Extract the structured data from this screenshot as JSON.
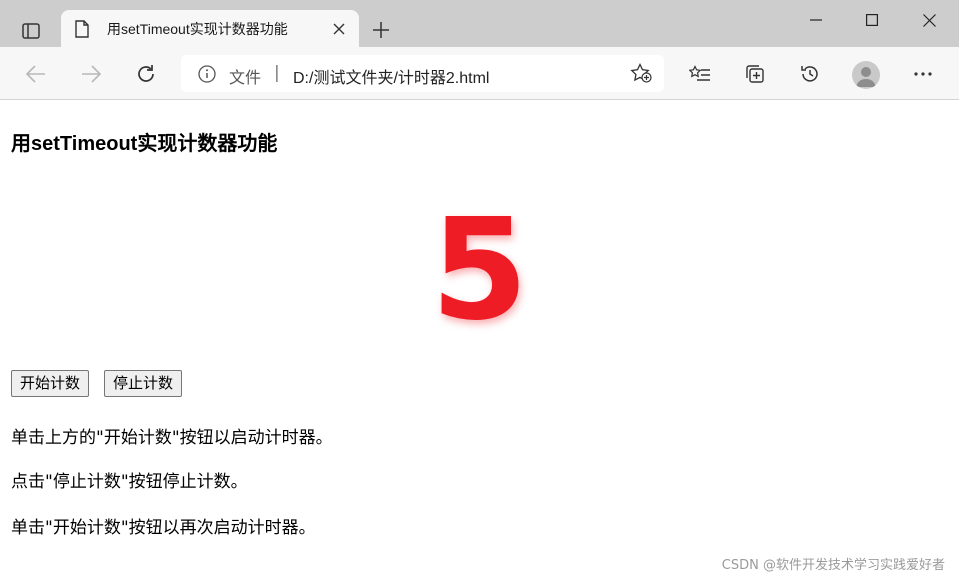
{
  "browser": {
    "tab_title": "用setTimeout实现计数器功能",
    "address": {
      "scheme_label": "文件",
      "separator": "|",
      "url": "D:/测试文件夹/计时器2.html"
    },
    "icons": {
      "tab_actions": "tab-actions-icon",
      "tab_doc": "document-icon",
      "tab_close": "close-icon",
      "new_tab": "plus-icon",
      "minimize": "minimize-icon",
      "maximize": "maximize-icon",
      "close_window": "close-icon",
      "back": "back-arrow-icon",
      "forward": "forward-arrow-icon",
      "refresh": "refresh-icon",
      "site_info": "info-icon",
      "add_favorite": "star-plus-icon",
      "favorites": "favorites-list-icon",
      "collections": "collections-icon",
      "history": "history-icon",
      "profile": "profile-avatar",
      "more": "more-icon"
    }
  },
  "page": {
    "title": "用setTimeout实现计数器功能",
    "counter_value": "5",
    "buttons": {
      "start": "开始计数",
      "stop": "停止计数"
    },
    "paragraphs": [
      "单击上方的\"开始计数\"按钮以启动计时器。",
      "点击\"停止计数\"按钮停止计数。",
      "单击\"开始计数\"按钮以再次启动计时器。"
    ],
    "watermark": "CSDN @软件开发技术学习实践爱好者"
  },
  "colors": {
    "counter": "#ee1c25",
    "tabstrip": "#cdcdcd",
    "toolbar": "#f7f7f7"
  }
}
